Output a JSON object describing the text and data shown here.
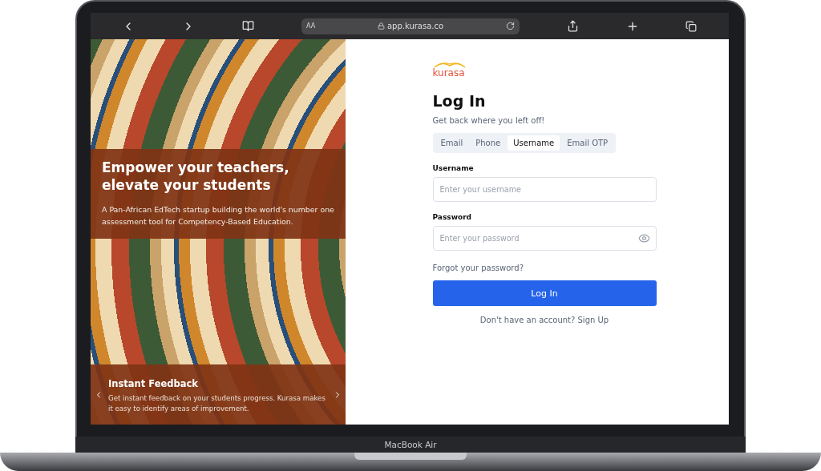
{
  "browser": {
    "reader_label": "AA",
    "url": "app.kurasa.co"
  },
  "hero": {
    "title": "Empower your teachers, elevate your students",
    "text": "A Pan-African EdTech startup building the world's number one assessment tool for Competency-Based Education."
  },
  "slide": {
    "title": "Instant Feedback",
    "text": "Get instant feedback on your students progress. Kurasa makes it easy to identify areas of improvement."
  },
  "logo": {
    "text": "kurasa"
  },
  "form": {
    "title": "Log In",
    "subtitle": "Get back where you left off!",
    "tabs": [
      {
        "label": "Email",
        "selected": false
      },
      {
        "label": "Phone",
        "selected": false
      },
      {
        "label": "Username",
        "selected": true
      },
      {
        "label": "Email OTP",
        "selected": false
      }
    ],
    "fields": [
      {
        "kind": "text",
        "label": "Username",
        "placeholder": "Enter your username"
      },
      {
        "kind": "password",
        "label": "Password",
        "placeholder": "Enter your password"
      }
    ],
    "forgot": "Forgot your password?",
    "submit": "Log In",
    "signup": "Don't have an account? Sign Up"
  },
  "device": {
    "label": "MacBook Air"
  }
}
